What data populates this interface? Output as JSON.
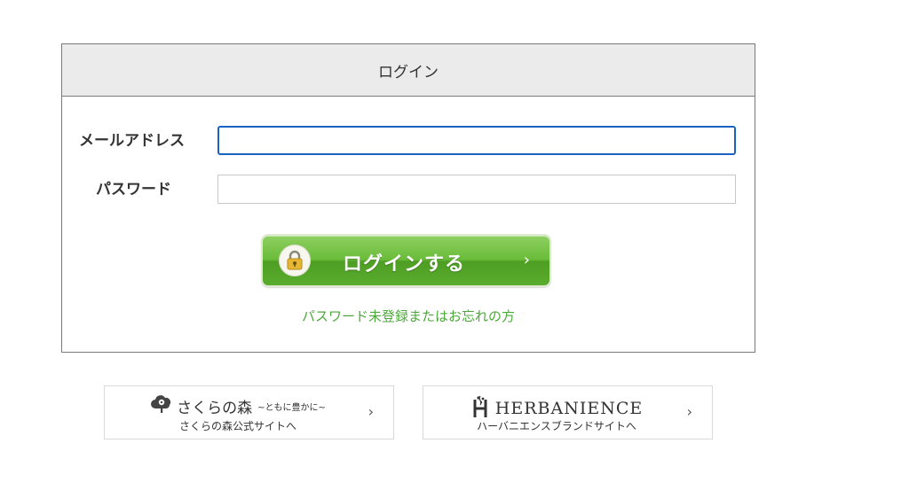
{
  "login": {
    "title": "ログイン",
    "email_label": "メールアドレス",
    "email_value": "",
    "password_label": "パスワード",
    "password_value": "",
    "submit_label": "ログインする",
    "forgot_link": "パスワード未登録またはお忘れの方"
  },
  "brands": [
    {
      "logo_name": "さくらの森",
      "logo_tagline": "~ともに豊かに~",
      "link_text": "さくらの森公式サイトへ"
    },
    {
      "logo_name": "HERBANIENCE",
      "link_text": "ハーバニエンスブランドサイトへ"
    }
  ],
  "icons": {
    "lock": "lock-icon",
    "chevron": "chevron-right-icon",
    "sakura_logo": "cloud-flower-icon",
    "herb_logo": "herb-h-icon"
  },
  "colors": {
    "button_green": "#5aac2e",
    "link_green": "#4ca83a",
    "focus_blue": "#1a63c4",
    "header_bg": "#ebebeb"
  }
}
